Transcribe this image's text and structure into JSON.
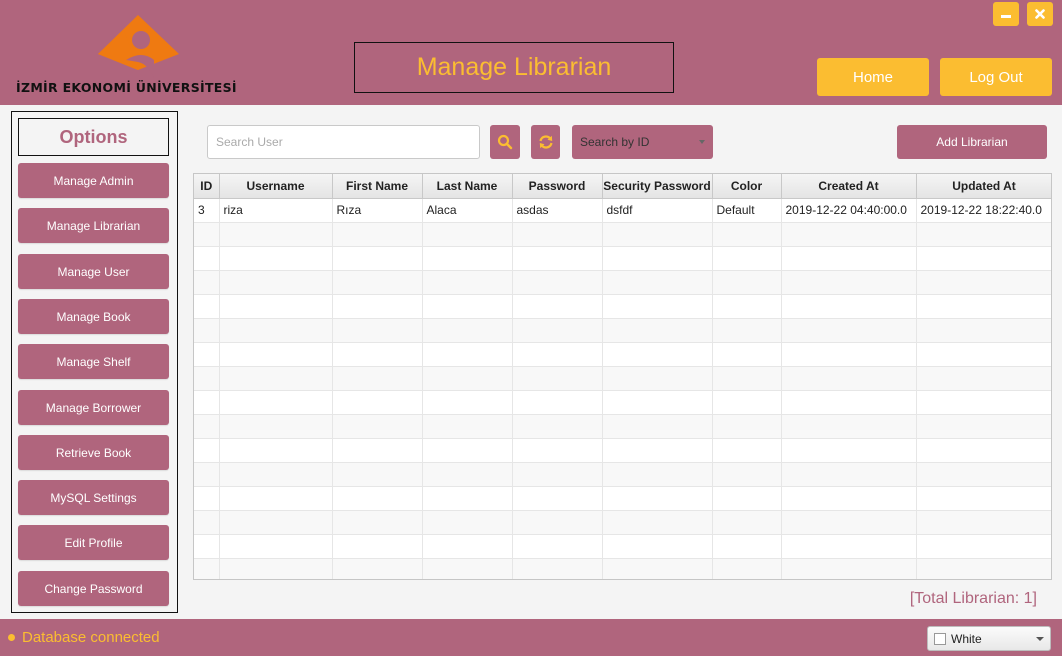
{
  "colors": {
    "primary": "#b0657d",
    "accent": "#fbbd31",
    "logo_orange": "#ef7a11"
  },
  "header": {
    "logo_text": "İZMİR EKONOMİ ÜNİVERSİTESİ",
    "title": "Manage Librarian",
    "home_label": "Home",
    "logout_label": "Log Out",
    "minimize_icon": "minimize-icon",
    "close_icon": "close-icon"
  },
  "sidebar": {
    "title": "Options",
    "items": [
      {
        "label": "Manage Admin"
      },
      {
        "label": "Manage Librarian"
      },
      {
        "label": "Manage User"
      },
      {
        "label": "Manage Book"
      },
      {
        "label": "Manage Shelf"
      },
      {
        "label": "Manage Borrower"
      },
      {
        "label": "Retrieve Book"
      },
      {
        "label": "MySQL Settings"
      },
      {
        "label": "Edit Profile"
      },
      {
        "label": "Change Password"
      }
    ]
  },
  "toolbar": {
    "search_placeholder": "Search User",
    "search_value": "",
    "search_icon": "search-icon",
    "refresh_icon": "refresh-icon",
    "search_by": "Search by ID",
    "add_label": "Add Librarian"
  },
  "table": {
    "columns": [
      "ID",
      "Username",
      "First Name",
      "Last Name",
      "Password",
      "Security Password",
      "Color",
      "Created At",
      "Updated At"
    ],
    "rows": [
      [
        "3",
        "riza",
        "Rıza",
        "Alaca",
        "asdas",
        "dsfdf",
        "Default",
        "2019-12-22 04:40:00.0",
        "2019-12-22 18:22:40.0"
      ]
    ]
  },
  "total_text": "[Total Librarian: 1]",
  "footer": {
    "status": "Database connected",
    "theme": "White"
  }
}
